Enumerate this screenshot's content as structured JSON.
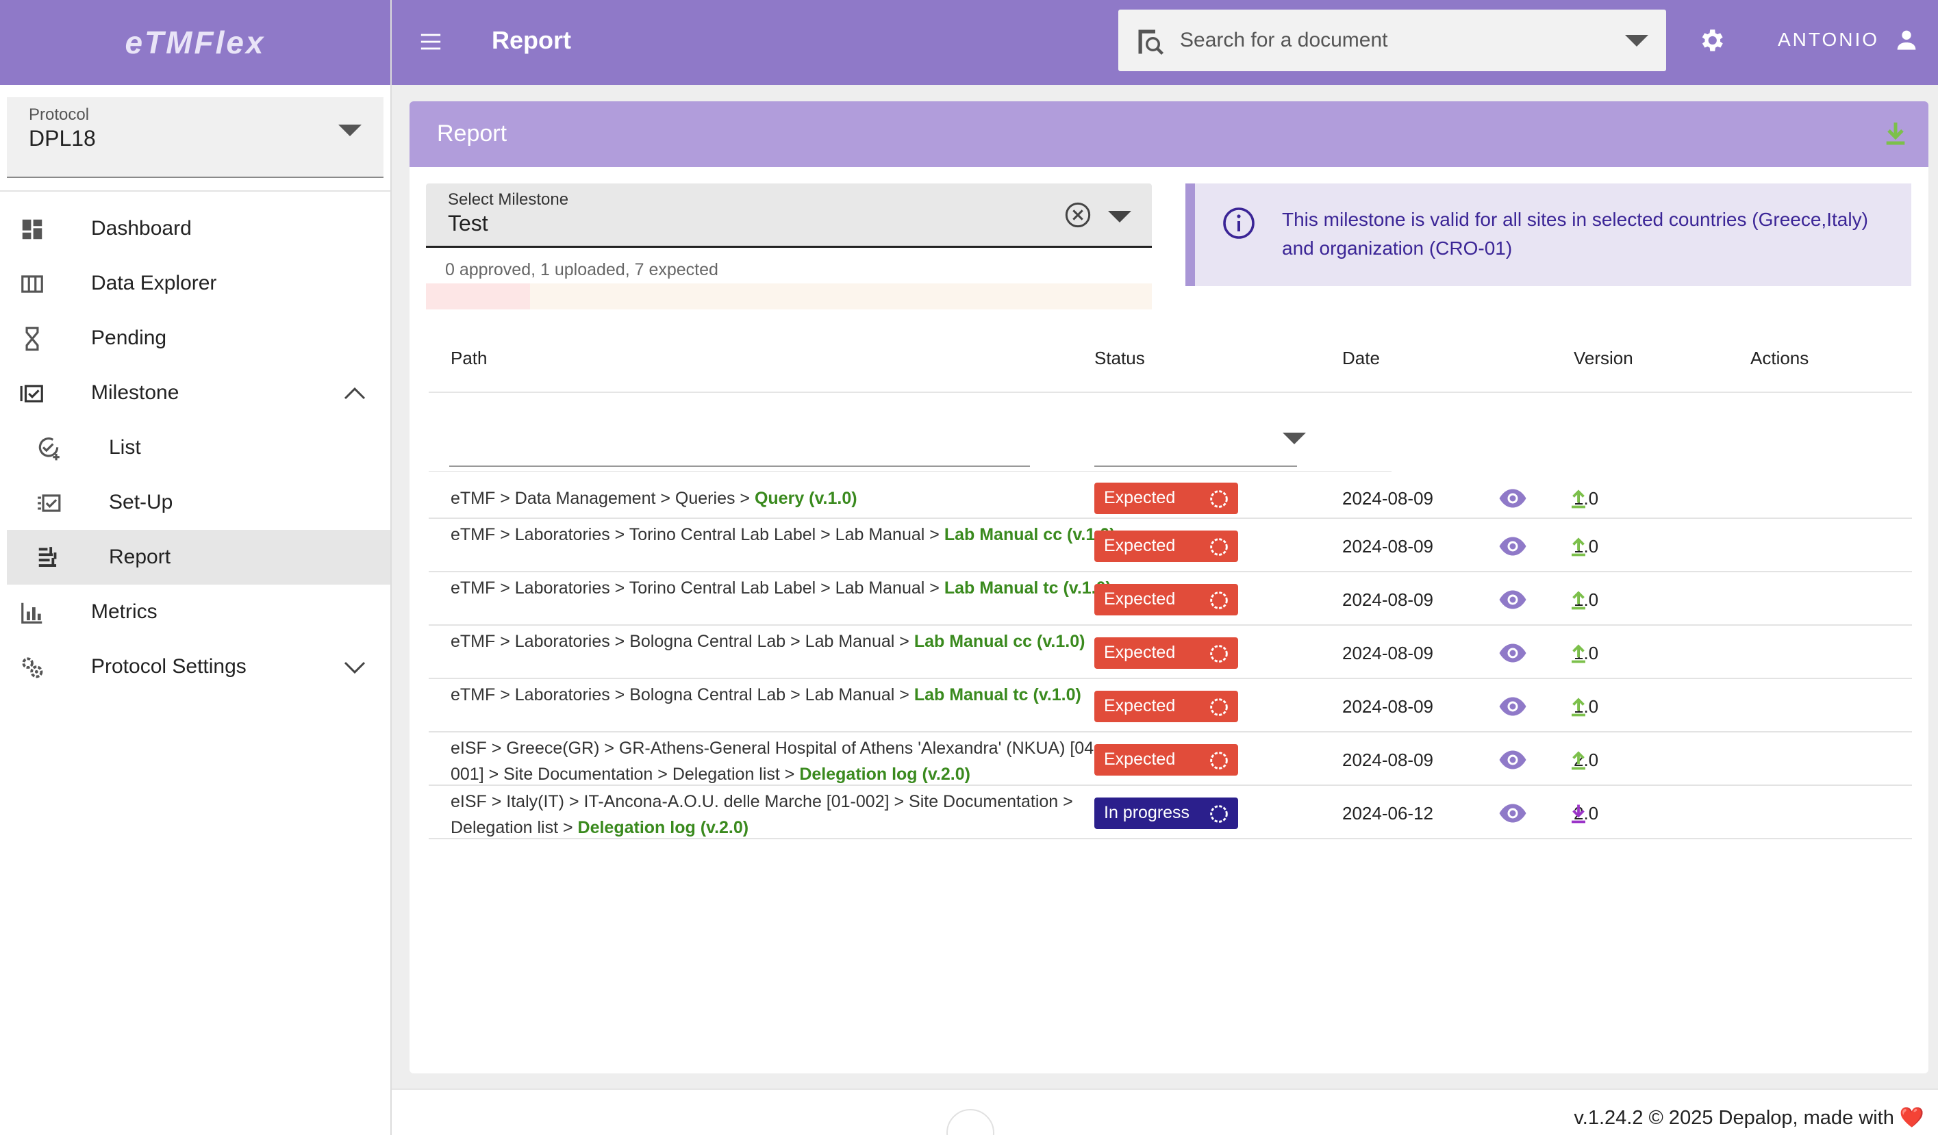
{
  "app": {
    "name": "eTMFlex"
  },
  "header": {
    "title": "Report",
    "search_placeholder": "Search for a document",
    "user": "ANTONIO"
  },
  "sidebar": {
    "protocol_label": "Protocol",
    "protocol_value": "DPL18",
    "items": [
      {
        "label": "Dashboard",
        "icon": "dashboard-icon"
      },
      {
        "label": "Data Explorer",
        "icon": "table-columns-icon"
      },
      {
        "label": "Pending",
        "icon": "hourglass-icon"
      },
      {
        "label": "Milestone",
        "icon": "milestone-checklist-icon",
        "expanded": true
      },
      {
        "label": "List",
        "icon": "circle-check-add-icon"
      },
      {
        "label": "Set-Up",
        "icon": "checklist-setup-icon"
      },
      {
        "label": "Report",
        "icon": "report-bars-icon",
        "active": true
      },
      {
        "label": "Metrics",
        "icon": "bar-chart-icon"
      },
      {
        "label": "Protocol Settings",
        "icon": "settings-gears-icon",
        "expanded": false
      }
    ]
  },
  "report": {
    "title": "Report",
    "milestone_label": "Select Milestone",
    "milestone_value": "Test",
    "summary": "0 approved, 1 uploaded, 7 expected",
    "progress_uploaded_fraction": 0.143,
    "info": "This milestone is valid for all sites in selected countries (Greece,Italy) and organization (CRO-01)",
    "columns": [
      "Path",
      "Status",
      "Date",
      "Version",
      "Actions"
    ],
    "rows": [
      {
        "path": "eTMF > Data Management > Queries > ",
        "doc": "Query (v.1.0)",
        "status": "Expected",
        "date": "2024-08-09",
        "version": "1.0",
        "action": "upload"
      },
      {
        "path": "eTMF > Laboratories > Torino Central Lab Label > Lab Manual > ",
        "doc": "Lab Manual cc (v.1.0)",
        "status": "Expected",
        "date": "2024-08-09",
        "version": "1.0",
        "action": "upload"
      },
      {
        "path": "eTMF > Laboratories > Torino Central Lab Label > Lab Manual > ",
        "doc": "Lab Manual tc (v.1.0)",
        "status": "Expected",
        "date": "2024-08-09",
        "version": "1.0",
        "action": "upload"
      },
      {
        "path": "eTMF > Laboratories > Bologna Central Lab > Lab Manual > ",
        "doc": "Lab Manual cc (v.1.0)",
        "status": "Expected",
        "date": "2024-08-09",
        "version": "1.0",
        "action": "upload"
      },
      {
        "path": "eTMF > Laboratories > Bologna Central Lab > Lab Manual > ",
        "doc": "Lab Manual tc (v.1.0)",
        "status": "Expected",
        "date": "2024-08-09",
        "version": "1.0",
        "action": "upload"
      },
      {
        "path": "eISF > Greece(GR) > GR-Athens-General Hospital of Athens 'Alexandra' (NKUA) [04-001] > Site Documentation > Delegation list > ",
        "doc": "Delegation log (v.2.0)",
        "status": "Expected",
        "date": "2024-08-09",
        "version": "2.0",
        "action": "upload"
      },
      {
        "path": "eISF > Italy(IT) > IT-Ancona-A.O.U. delle Marche [01-002] > Site Documentation > Delegation list > ",
        "doc": "Delegation log (v.2.0)",
        "status": "In progress",
        "date": "2024-06-12",
        "version": "2.0",
        "action": "download"
      }
    ]
  },
  "footer": {
    "text": "v.1.24.2 © 2025 Depalop, made with ",
    "heart": "❤️"
  },
  "colors": {
    "primary": "#8f79c8",
    "header_card": "#b19ddb",
    "expected": "#e14c3a",
    "in_progress": "#2b1f8c",
    "doc_link": "#3a8a1e",
    "upload": "#7cc04b",
    "download": "#9b34c8"
  }
}
